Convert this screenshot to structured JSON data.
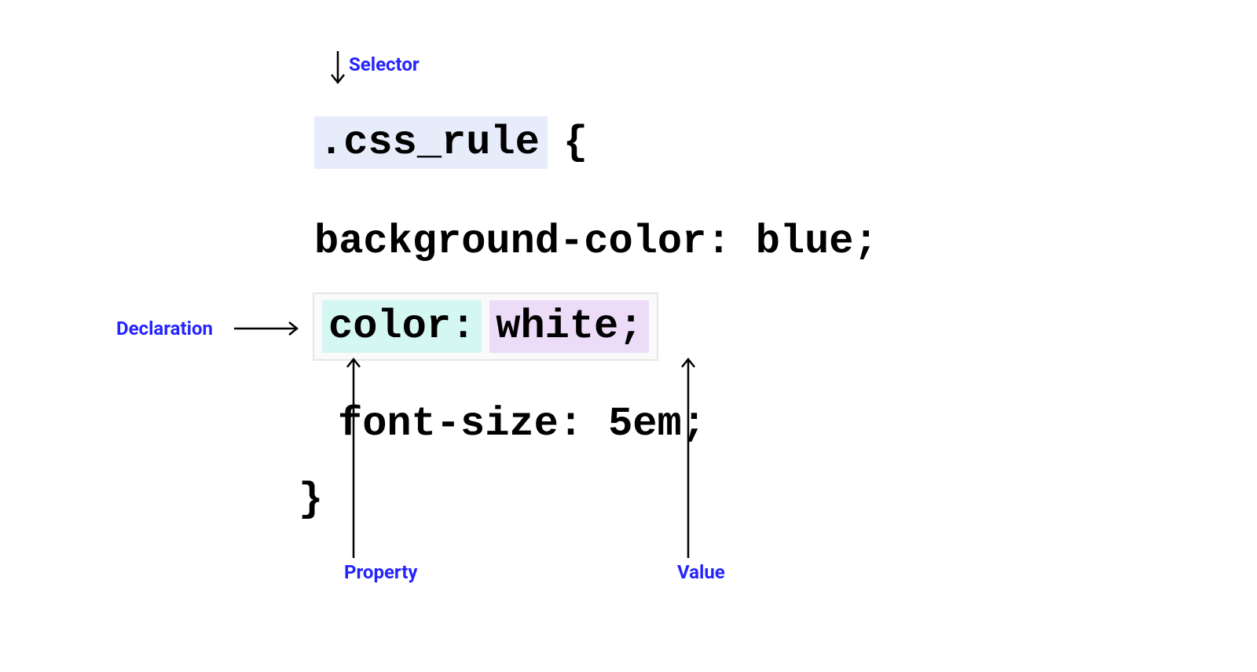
{
  "labels": {
    "selector": "Selector",
    "declaration": "Declaration",
    "property": "Property",
    "value": "Value"
  },
  "code": {
    "selector": ".css_rule",
    "open_brace": "{",
    "line1": "background-color: blue;",
    "property": "color:",
    "value": "white;",
    "line3_prop": "font-size:",
    "line3_val": "5em;",
    "close_brace": "}"
  },
  "colors": {
    "label": "#2424ff",
    "selector_bg": "#e6ecfa",
    "property_bg": "#d4f7f2",
    "value_bg": "#ecdcf8",
    "decl_border": "#e6e6e6",
    "decl_bg": "#fafafa"
  }
}
